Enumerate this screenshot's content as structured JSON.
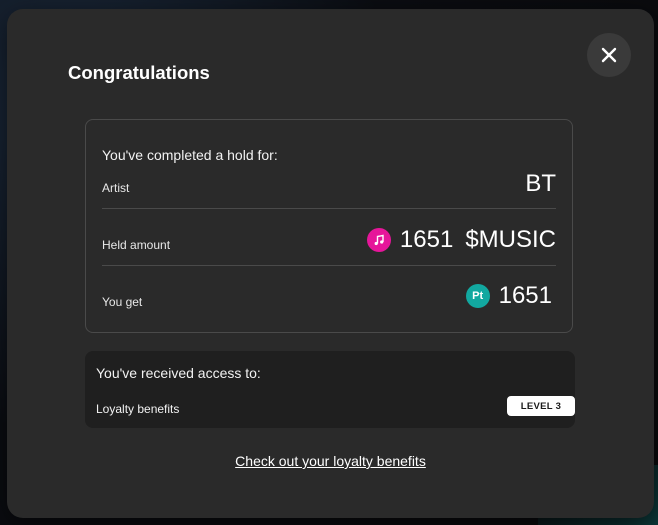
{
  "modal": {
    "title": "Congratulations",
    "close_icon": "close-icon"
  },
  "hold": {
    "intro": "You've completed a hold for:",
    "rows": [
      {
        "label": "Artist",
        "value": "BT"
      },
      {
        "label": "Held amount",
        "icon": "music-note-icon",
        "amount": "1651",
        "unit": "$MUSIC",
        "icon_color": "#e6169a"
      },
      {
        "label": "You get",
        "icon": "points-icon",
        "icon_text": "Pt",
        "amount": "1651",
        "icon_color": "#12a8a0"
      }
    ]
  },
  "access": {
    "heading": "You've received access to:",
    "benefit": "Loyalty benefits",
    "level": "LEVEL 3"
  },
  "link": {
    "label": "Check out your loyalty benefits"
  }
}
